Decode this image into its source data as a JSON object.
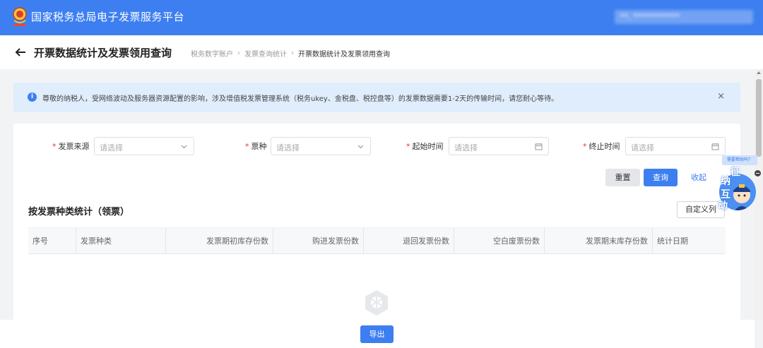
{
  "header": {
    "app_title": "国家税务总局电子发票服务平台",
    "user_info": "**, ************"
  },
  "crumbbar": {
    "page_title": "开票数据统计及发票领用查询",
    "breadcrumb": [
      "税务数字账户",
      "发票查询统计",
      "开票数据统计及发票领用查询"
    ]
  },
  "notice": {
    "text": "尊敬的纳税人，受网络波动及服务器资源配置的影响，涉及增值税发票管理系统（税务ukey、金税盘、税控盘等）的发票数据需要1-2天的传输时间，请您耐心等待。",
    "close": "×"
  },
  "filters": [
    {
      "label": "发票来源",
      "placeholder": "请选择",
      "icon": "chevron-down-icon"
    },
    {
      "label": "票种",
      "placeholder": "请选择",
      "icon": "chevron-down-icon"
    },
    {
      "label": "起始时间",
      "placeholder": "请选择",
      "icon": "calendar-icon"
    },
    {
      "label": "终止时间",
      "placeholder": "请选择",
      "icon": "calendar-icon"
    }
  ],
  "required_mark": "*",
  "buttons": {
    "reset": "重置",
    "query": "查询",
    "collapse": "收起",
    "custom_columns": "自定义列",
    "export": "导出"
  },
  "section": {
    "title": "按发票种类统计（领票）"
  },
  "table": {
    "columns": [
      "序号",
      "发票种类",
      "发票期初库存份数",
      "购进发票份数",
      "退回发票份数",
      "空白废票份数",
      "发票期末库存份数",
      "统计日期"
    ],
    "rows": []
  },
  "helper": {
    "bubble": "需要帮助吗？",
    "chars": [
      "征",
      "纳",
      "互",
      "动"
    ]
  },
  "colors": {
    "brand": "#3d7ff0",
    "notice_bg": "#dfedfc",
    "required": "#e33333"
  }
}
